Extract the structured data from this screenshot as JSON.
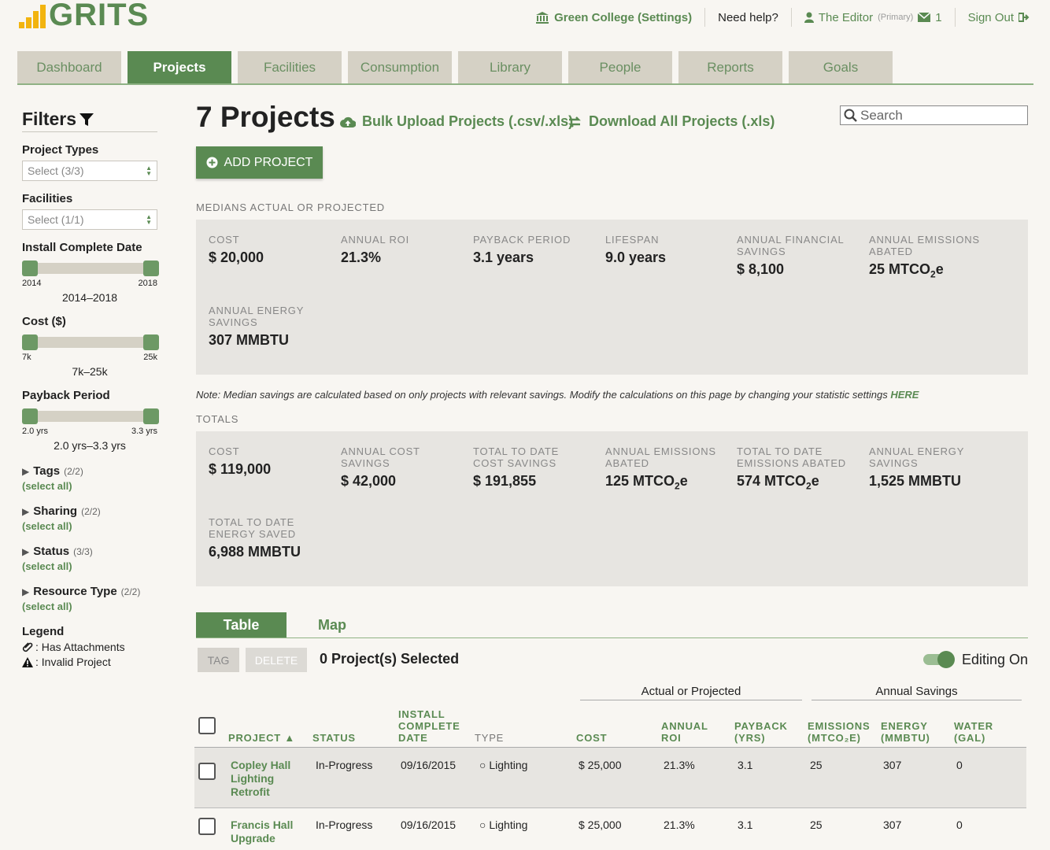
{
  "header": {
    "logo": "GRITS",
    "org": "Green College (Settings)",
    "help": "Need help?",
    "user": "The Editor",
    "role": "(Primary)",
    "messages": "1",
    "signout": "Sign Out"
  },
  "tabs": [
    "Dashboard",
    "Projects",
    "Facilities",
    "Consumption",
    "Library",
    "People",
    "Reports",
    "Goals"
  ],
  "sidebar": {
    "title": "Filters",
    "project_types_label": "Project Types",
    "project_types_value": "Select (3/3)",
    "facilities_label": "Facilities",
    "facilities_value": "Select (1/1)",
    "install_label": "Install Complete Date",
    "install_min": "2014",
    "install_max": "2018",
    "install_range": "2014–2018",
    "cost_label": "Cost ($)",
    "cost_min": "7k",
    "cost_max": "25k",
    "cost_range": "7k–25k",
    "payback_label": "Payback Period",
    "payback_min": "2.0 yrs",
    "payback_max": "3.3 yrs",
    "payback_range": "2.0 yrs–3.3 yrs",
    "groups": [
      {
        "label": "Tags",
        "count": "(2/2)"
      },
      {
        "label": "Sharing",
        "count": "(2/2)"
      },
      {
        "label": "Status",
        "count": "(3/3)"
      },
      {
        "label": "Resource Type",
        "count": "(2/2)"
      }
    ],
    "select_all": "(select all)",
    "legend_title": "Legend",
    "legend_attach": ": Has Attachments",
    "legend_invalid": ": Invalid Project"
  },
  "main": {
    "title": "7 Projects",
    "bulk_upload": "Bulk Upload Projects (.csv/.xls)",
    "download_all": "Download All Projects (.xls)",
    "search_placeholder": "Search",
    "add_project": "ADD PROJECT",
    "medians_label": "MEDIANS ACTUAL OR PROJECTED",
    "medians": [
      {
        "k": "Cost",
        "v": "$ 20,000"
      },
      {
        "k": "Annual ROI",
        "v": "21.3%"
      },
      {
        "k": "Payback Period",
        "v": "3.1 years"
      },
      {
        "k": "Lifespan",
        "v": "9.0 years"
      },
      {
        "k": "Annual Financial Savings",
        "v": "$ 8,100"
      },
      {
        "k": "Annual Emissions Abated",
        "v": "25 MTCO",
        "sub": "2",
        "suffix": "e"
      },
      {
        "k": "Annual Energy Savings",
        "v": "307 MMBTU"
      }
    ],
    "note": "Note: Median savings are calculated based on only projects with relevant savings. Modify the calculations on this page by changing your statistic settings",
    "note_link": "HERE",
    "totals_label": "TOTALS",
    "totals": [
      {
        "k": "Cost",
        "v": "$ 119,000"
      },
      {
        "k": "Annual Cost Savings",
        "v": "$ 42,000"
      },
      {
        "k": "Total to Date Cost Savings",
        "v": "$ 191,855"
      },
      {
        "k": "Annual Emissions Abated",
        "v": "125 MTCO",
        "sub": "2",
        "suffix": "e"
      },
      {
        "k": "Total to Date Emissions Abated",
        "v": "574 MTCO",
        "sub": "2",
        "suffix": "e"
      },
      {
        "k": "Annual Energy Savings",
        "v": "1,525 MMBTU"
      },
      {
        "k": "Total to Date Energy Saved",
        "v": "6,988 MMBTU"
      }
    ],
    "view_table": "Table",
    "view_map": "Map",
    "tag_btn": "TAG",
    "delete_btn": "DELETE",
    "selected": "0 Project(s) Selected",
    "editing": "Editing On",
    "group_actual": "Actual or Projected",
    "group_annual": "Annual Savings",
    "columns": {
      "project": "PROJECT ▲",
      "status": "STATUS",
      "install": "INSTALL COMPLETE DATE",
      "type": "TYPE",
      "cost": "COST",
      "roi": "ANNUAL ROI",
      "payback": "PAYBACK (YRS)",
      "emissions": "EMISSIONS (MTCO₂E)",
      "energy": "ENERGY (MMBTU)",
      "water": "WATER (GAL)"
    },
    "rows": [
      {
        "name": "Copley Hall Lighting Retrofit",
        "status": "In-Progress",
        "date": "09/16/2015",
        "type": "Lighting",
        "cost": "$ 25,000",
        "roi": "21.3%",
        "payback": "3.1",
        "emissions": "25",
        "energy": "307",
        "water": "0"
      },
      {
        "name": "Francis Hall Upgrade",
        "status": "In-Progress",
        "date": "09/16/2015",
        "type": "Lighting",
        "cost": "$ 25,000",
        "roi": "21.3%",
        "payback": "3.1",
        "emissions": "25",
        "energy": "307",
        "water": "0"
      }
    ]
  }
}
